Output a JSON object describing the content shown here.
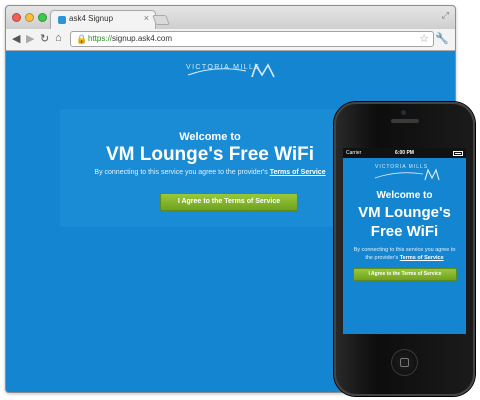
{
  "browser": {
    "tab_title": "ask4 Signup",
    "tab_close": "×",
    "url_scheme": "https://",
    "url_rest": "signup.ask4.com",
    "icons": {
      "back": "◀",
      "forward": "▶",
      "reload": "↻",
      "home": "⌂",
      "lock": "🔒",
      "star": "☆",
      "wrench": "🔧",
      "fullscreen": "⤢"
    }
  },
  "page": {
    "logo_text": "VICTORIA MILLS",
    "welcome": "Welcome to",
    "headline": "VM Lounge's Free WiFi",
    "consent_prefix": "By connecting to this service you agree to the provider's",
    "consent_link": "Terms of Service",
    "agree_button": "I Agree to the Terms of Service"
  },
  "phone": {
    "carrier": "Carrier",
    "time": "6:00 PM",
    "logo_text": "VICTORIA MILLS",
    "welcome": "Welcome to",
    "headline": "VM Lounge's Free WiFi",
    "consent_prefix": "By connecting to this service you agree to the provider's",
    "consent_link": "Terms of Service",
    "agree_button": "I Agree to the Terms of Service"
  },
  "colors": {
    "background_blue": "#1486d1",
    "button_green": "#7cb02a",
    "address_secure_green": "#2a8a2a"
  }
}
